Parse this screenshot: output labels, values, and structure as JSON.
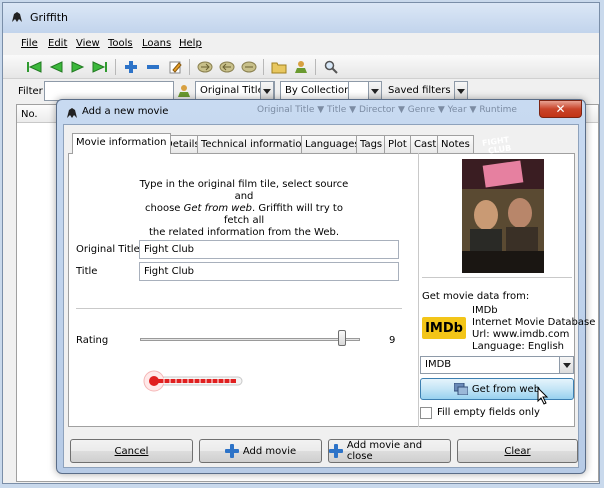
{
  "window": {
    "title": "Griffith"
  },
  "menu": [
    "File",
    "Edit",
    "View",
    "Tools",
    "Loans",
    "Help"
  ],
  "filterbar": {
    "filter_label": "Filter",
    "field_select": "Original Title",
    "collection_select": "By Collection",
    "saved_filters": "Saved filters"
  },
  "list": {
    "col_no": "No."
  },
  "dialog": {
    "title": "Add a new movie",
    "background_header_text": "Original Title ▼  Title ▼  Director ▼  Genre ▼  Year ▼  Runtime",
    "tabs": [
      "Movie information",
      "Details",
      "Technical information",
      "Languages",
      "Tags",
      "Plot",
      "Cast",
      "Notes"
    ],
    "instructions_1": "Type in the original film tile, select source and",
    "instructions_2a": "choose ",
    "instructions_2b": "Get from web",
    "instructions_2c": ". Griffith will try to fetch all",
    "instructions_3": "the related information from the Web.",
    "original_title_label": "Original Title",
    "original_title_value": "Fight Club",
    "title_label": "Title",
    "title_value": "Fight Club",
    "rating_label": "Rating",
    "rating_value": "9",
    "rating_fraction": 0.9,
    "poster": {
      "title_line1": "FIGHT",
      "title_line2": "CLUB"
    },
    "source_heading": "Get movie data from:",
    "source_name": "IMDb",
    "source_full": "Internet Movie Database",
    "source_url": "Url: www.imdb.com",
    "source_language": "Language: English",
    "source_logo": "IMDb",
    "source_select": "IMDB",
    "get_from_web": "Get from web",
    "fill_empty": "Fill empty fields only",
    "buttons": {
      "cancel": "Cancel",
      "add_movie": "Add movie",
      "add_close": "Add movie and close",
      "clear": "Clear"
    }
  },
  "colors": {
    "accent": "#3c7fb1",
    "imdb_yellow": "#f3c518",
    "close_red": "#c23416"
  }
}
